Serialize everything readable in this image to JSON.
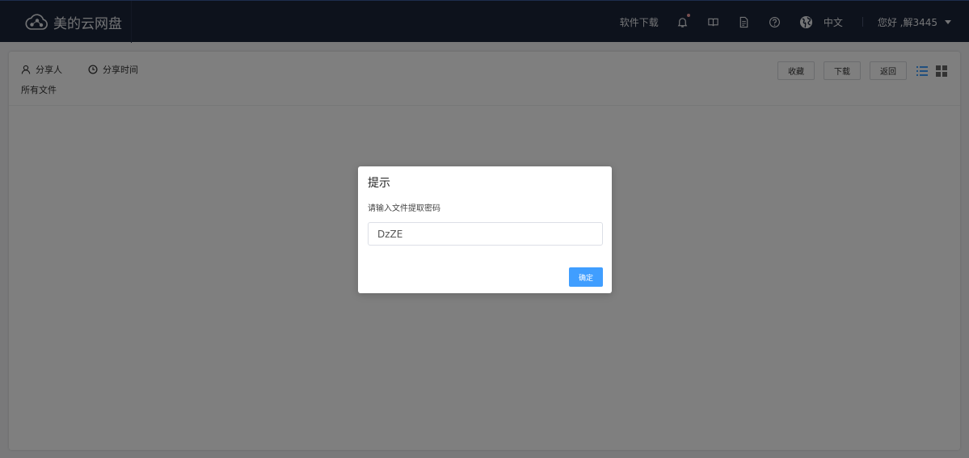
{
  "header": {
    "logo_text": "美的云网盘",
    "software_download": "软件下载",
    "language": "中文",
    "greeting": "您好 ,解3445"
  },
  "panel": {
    "sharer_label": "分享人",
    "share_time_label": "分享时间",
    "all_files": "所有文件",
    "buttons": {
      "favorite": "收藏",
      "download": "下载",
      "back": "返回"
    }
  },
  "dialog": {
    "title": "提示",
    "message": "请输入文件提取密码",
    "input_value": "DzZE",
    "ok_label": "确定"
  },
  "colors": {
    "header_bg": "#1b2438",
    "primary": "#409eff",
    "notification_dot": "#f2a0a0"
  }
}
